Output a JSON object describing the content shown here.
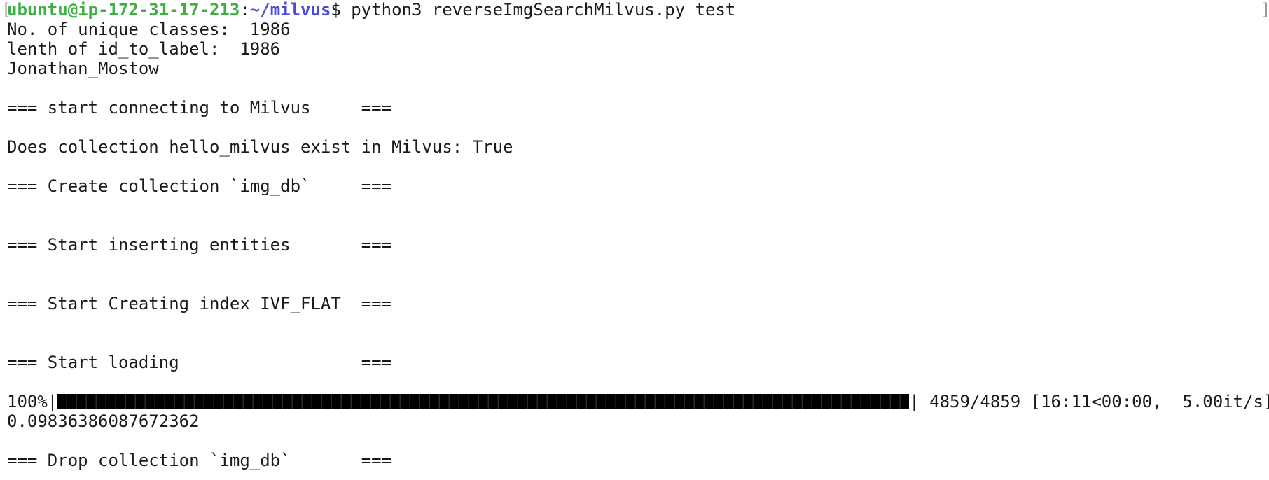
{
  "terminal": {
    "prompt": {
      "user_host": "ubuntu@ip-172-31-17-213",
      "separator": ":",
      "path": "~/milvus",
      "symbol": "$",
      "command": " python3 reverseImgSearchMilvus.py test"
    },
    "lines": {
      "unique_classes": "No. of unique classes:  1986",
      "id_to_label": "lenth of id_to_label:  1986",
      "name": "Jonathan_Mostow",
      "connecting": "=== start connecting to Milvus     ===",
      "collection_exists": "Does collection hello_milvus exist in Milvus: True",
      "create_collection": "=== Create collection `img_db`     ===",
      "inserting": "=== Start inserting entities       ===",
      "creating_index": "=== Start Creating index IVF_FLAT  ===",
      "loading": "=== Start loading                  ===",
      "result_value": "0.09836386087672362",
      "drop_collection": "=== Drop collection `img_db`       ==="
    },
    "progress": {
      "percent_text": "100%",
      "fraction": 1.0,
      "stats": " 4859/4859 [16:11<00:00,  5.00it/s]"
    },
    "colors": {
      "user_host": "#3cb043",
      "path": "#4a4ad6",
      "text": "#1a1a1a",
      "background": "#ffffff"
    }
  }
}
